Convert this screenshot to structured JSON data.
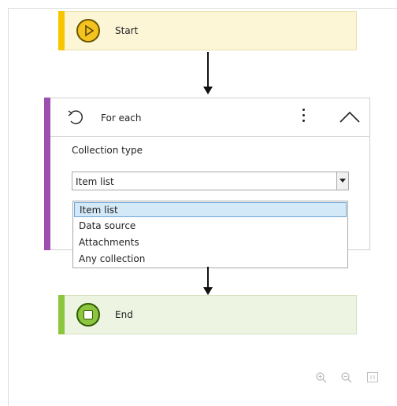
{
  "workflow": {
    "start": {
      "label": "Start",
      "icon": "play-icon",
      "accent": "#f7c400"
    },
    "foreach": {
      "title": "For each",
      "icon": "loop-icon",
      "accent": "#9b4fb0",
      "collection_label": "Collection type",
      "select": {
        "value": "Item list",
        "options": [
          "Item list",
          "Data source",
          "Attachments",
          "Any collection"
        ],
        "highlighted": "Item list"
      }
    },
    "end": {
      "label": "End",
      "icon": "stop-icon",
      "accent": "#8cc63f"
    }
  },
  "zoom_controls": {
    "icons": [
      "zoom-in-icon",
      "zoom-out-icon",
      "fit-to-screen-icon"
    ]
  }
}
